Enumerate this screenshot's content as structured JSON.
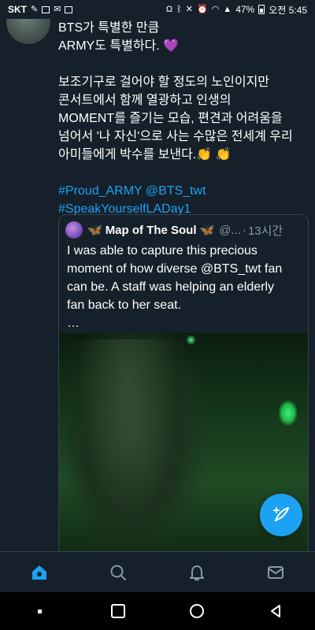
{
  "status_bar": {
    "carrier": "SKT",
    "battery": "47%",
    "time": "오전 5:45"
  },
  "tweet": {
    "line1": "BTS가 특별한 만큼",
    "line2": "ARMY도 특별하다.",
    "heart_emoji": "💜",
    "paragraph": "보조기구로 걸어야 할 정도의 노인이지만\n콘서트에서 함께 열광하고 인생의\nMOMENT를 즐기는 모습, 편견과 어려움을\n넘어서 '나 자신'으로 사는 수많은 전세계 우리\n아미들에게 박수를 보낸다.",
    "clap_emojis": "👏 👏",
    "hashtag_line1": "#Proud_ARMY @BTS_twt",
    "hashtag_line2": "#SpeakYourselfLADay1"
  },
  "quote": {
    "name": "Map of The Soul",
    "butterfly": "🦋",
    "handle": "@...",
    "time": "13시간",
    "text": "I was able to capture this precious\nmoment of how diverse @BTS_twt fan\ncan be. A staff was helping an elderly\nfan back to her seat.\n…"
  },
  "icons": {
    "fab": "compose-tweet-icon",
    "nav": [
      "home-icon",
      "search-icon",
      "notifications-icon",
      "messages-icon"
    ],
    "system": [
      "recents-icon",
      "home-button-icon",
      "back-icon"
    ]
  },
  "colors": {
    "background": "#15202b",
    "accent": "#1da1f2",
    "border": "#38444d",
    "muted": "#8899a6"
  }
}
